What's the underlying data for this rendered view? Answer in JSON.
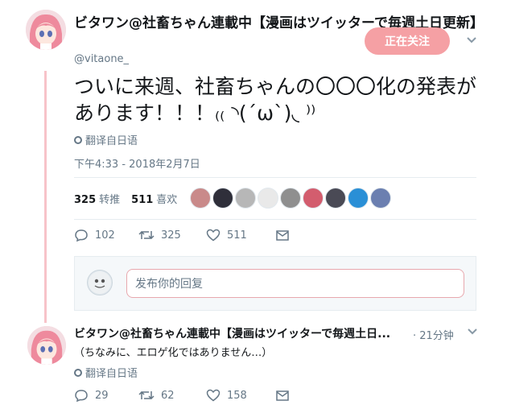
{
  "main_tweet": {
    "display_name": "ビタワン@社畜ちゃん連載中【漫画はツイッターで毎週土日更新】",
    "handle": "@vitaone_",
    "follow_button": "正在关注",
    "text": "ついに来週、社畜ちゃんの〇〇〇化の発表があります！！！₍₍ ◝(´ω`)◟ ⁾⁾",
    "translate": "翻译自日语",
    "timestamp": "下午4:33 - 2018年2月7日",
    "stats": {
      "retweets_count": "325",
      "retweets_label": "转推",
      "likes_count": "511",
      "likes_label": "喜欢"
    },
    "likers": [
      "#c98a8a",
      "#2f2f3a",
      "#b7b7b7",
      "#e9e9e9",
      "#8f8f8f",
      "#d35d6e",
      "#4a4a55",
      "#2a8fd6",
      "#6b7fb0"
    ],
    "actions": {
      "replies": "102",
      "retweets": "325",
      "likes": "511"
    }
  },
  "reply_box": {
    "placeholder": "发布你的回复"
  },
  "reply_tweet": {
    "display_name": "ビタワン@社畜ちゃん連載中【漫画はツイッターで毎週土日...",
    "time": "· 21分钟",
    "text": "（ちなみに、エロゲ化ではありません…）",
    "translate": "翻译自日语",
    "actions": {
      "replies": "29",
      "retweets": "62",
      "likes": "158"
    }
  },
  "colors": {
    "accent": "#f5a0a4",
    "thread": "#f7c3c9",
    "muted": "#657786"
  }
}
